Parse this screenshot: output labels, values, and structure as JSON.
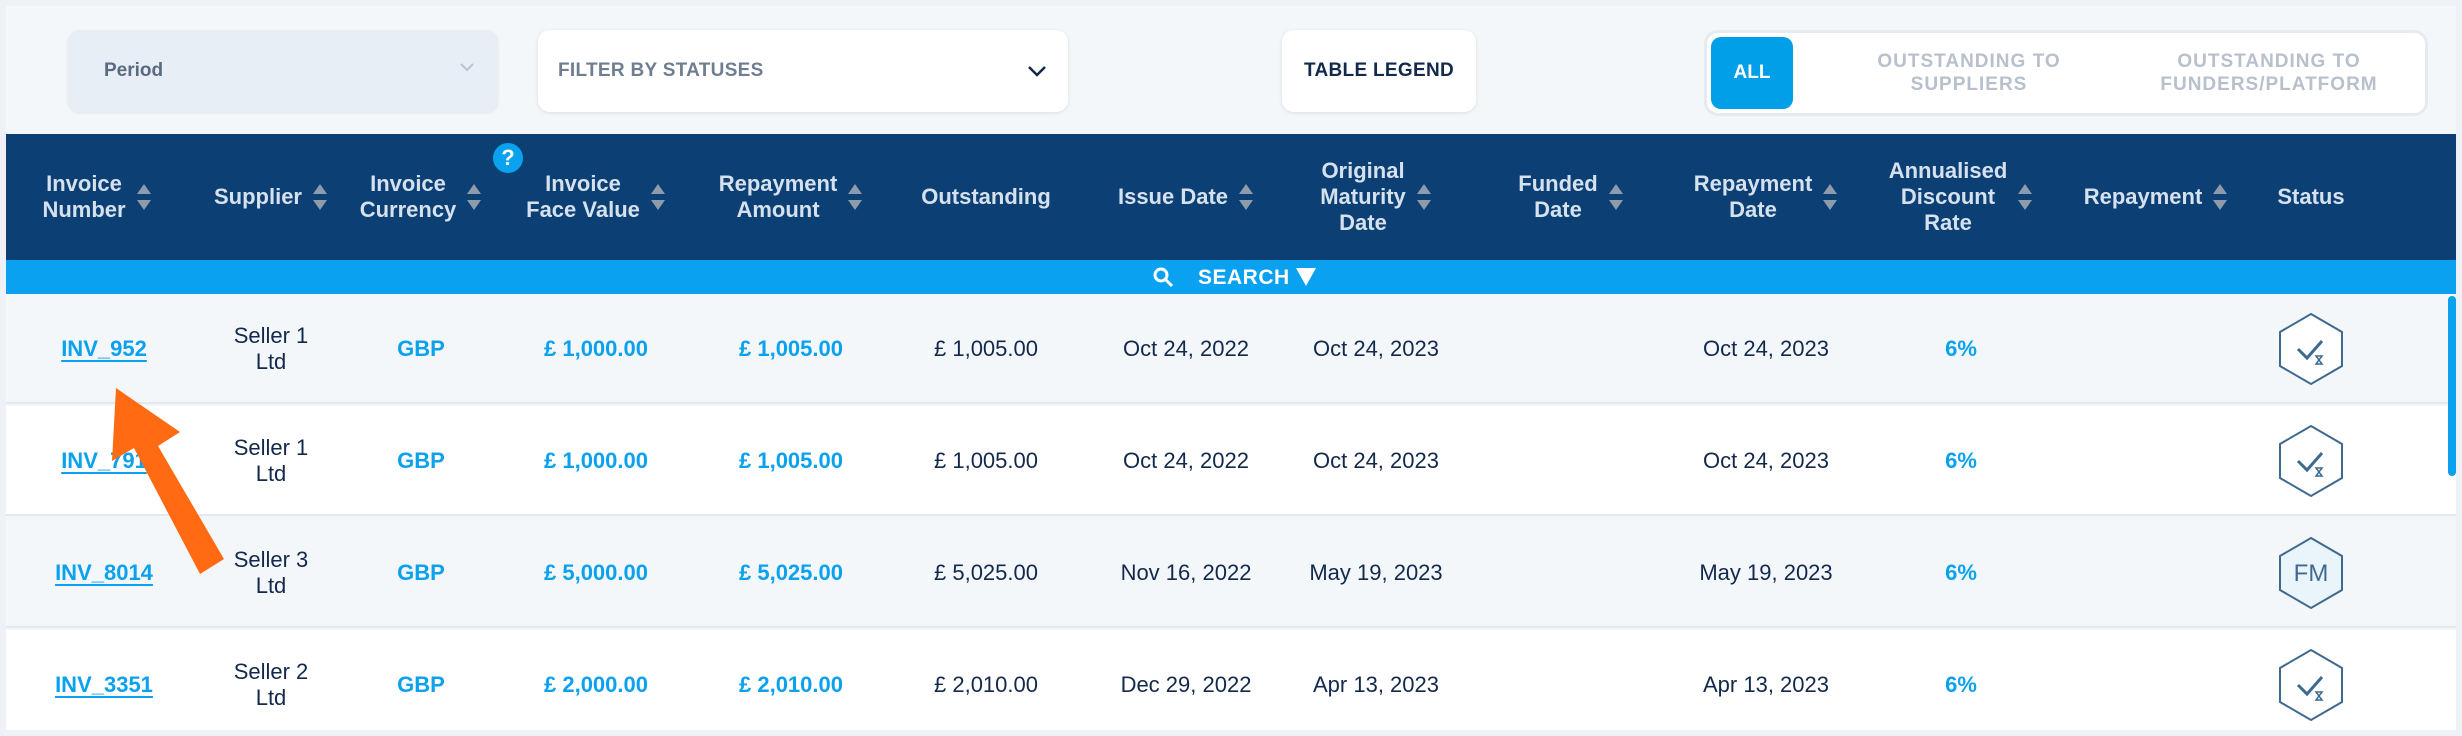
{
  "filters": {
    "period_label": "Period",
    "statuses_placeholder": "FILTER BY STATUSES",
    "legend_label": "TABLE LEGEND",
    "segments": [
      "ALL",
      "OUTSTANDING TO\nSUPPLIERS",
      "OUTSTANDING TO\nFUNDERS/PLATFORM"
    ]
  },
  "colors": {
    "header_bg": "#0c3f74",
    "accent": "#0aa1ee",
    "search_bar": "#0aa1f0",
    "annotation_arrow": "#ff6a13"
  },
  "table": {
    "help_badge": "?",
    "search_label": "SEARCH",
    "columns": [
      "Invoice\nNumber",
      "Supplier",
      "Invoice\nCurrency",
      "Invoice\nFace Value",
      "Repayment\nAmount",
      "Outstanding",
      "Issue Date",
      "Original\nMaturity\nDate",
      "Funded\nDate",
      "Repayment\nDate",
      "Annualised\nDiscount\nRate",
      "Repayment",
      "Status"
    ],
    "rows": [
      {
        "invoice": "INV_952",
        "supplier": "Seller 1\nLtd",
        "currency": "GBP",
        "face_value": "£ 1,000.00",
        "repayment_amount": "£ 1,005.00",
        "outstanding": "£ 1,005.00",
        "issue_date": "Oct 24, 2022",
        "maturity_date": "Oct 24, 2023",
        "funded_date": "",
        "repayment_date": "Oct 24, 2023",
        "discount_rate": "6%",
        "repayment": "",
        "status_icon": "check-hexagon-icon",
        "status_text": ""
      },
      {
        "invoice": "INV_791",
        "supplier": "Seller 1\nLtd",
        "currency": "GBP",
        "face_value": "£ 1,000.00",
        "repayment_amount": "£ 1,005.00",
        "outstanding": "£ 1,005.00",
        "issue_date": "Oct 24, 2022",
        "maturity_date": "Oct 24, 2023",
        "funded_date": "",
        "repayment_date": "Oct 24, 2023",
        "discount_rate": "6%",
        "repayment": "",
        "status_icon": "check-hexagon-icon",
        "status_text": ""
      },
      {
        "invoice": "INV_8014",
        "supplier": "Seller 3\nLtd",
        "currency": "GBP",
        "face_value": "£ 5,000.00",
        "repayment_amount": "£ 5,025.00",
        "outstanding": "£ 5,025.00",
        "issue_date": "Nov 16, 2022",
        "maturity_date": "May 19, 2023",
        "funded_date": "",
        "repayment_date": "May 19, 2023",
        "discount_rate": "6%",
        "repayment": "",
        "status_icon": "fm-hexagon-icon",
        "status_text": "FM"
      },
      {
        "invoice": "INV_3351",
        "supplier": "Seller 2\nLtd",
        "currency": "GBP",
        "face_value": "£ 2,000.00",
        "repayment_amount": "£ 2,010.00",
        "outstanding": "£ 2,010.00",
        "issue_date": "Dec 29, 2022",
        "maturity_date": "Apr 13, 2023",
        "funded_date": "",
        "repayment_date": "Apr 13, 2023",
        "discount_rate": "6%",
        "repayment": "",
        "status_icon": "check-hexagon-icon",
        "status_text": ""
      }
    ]
  }
}
